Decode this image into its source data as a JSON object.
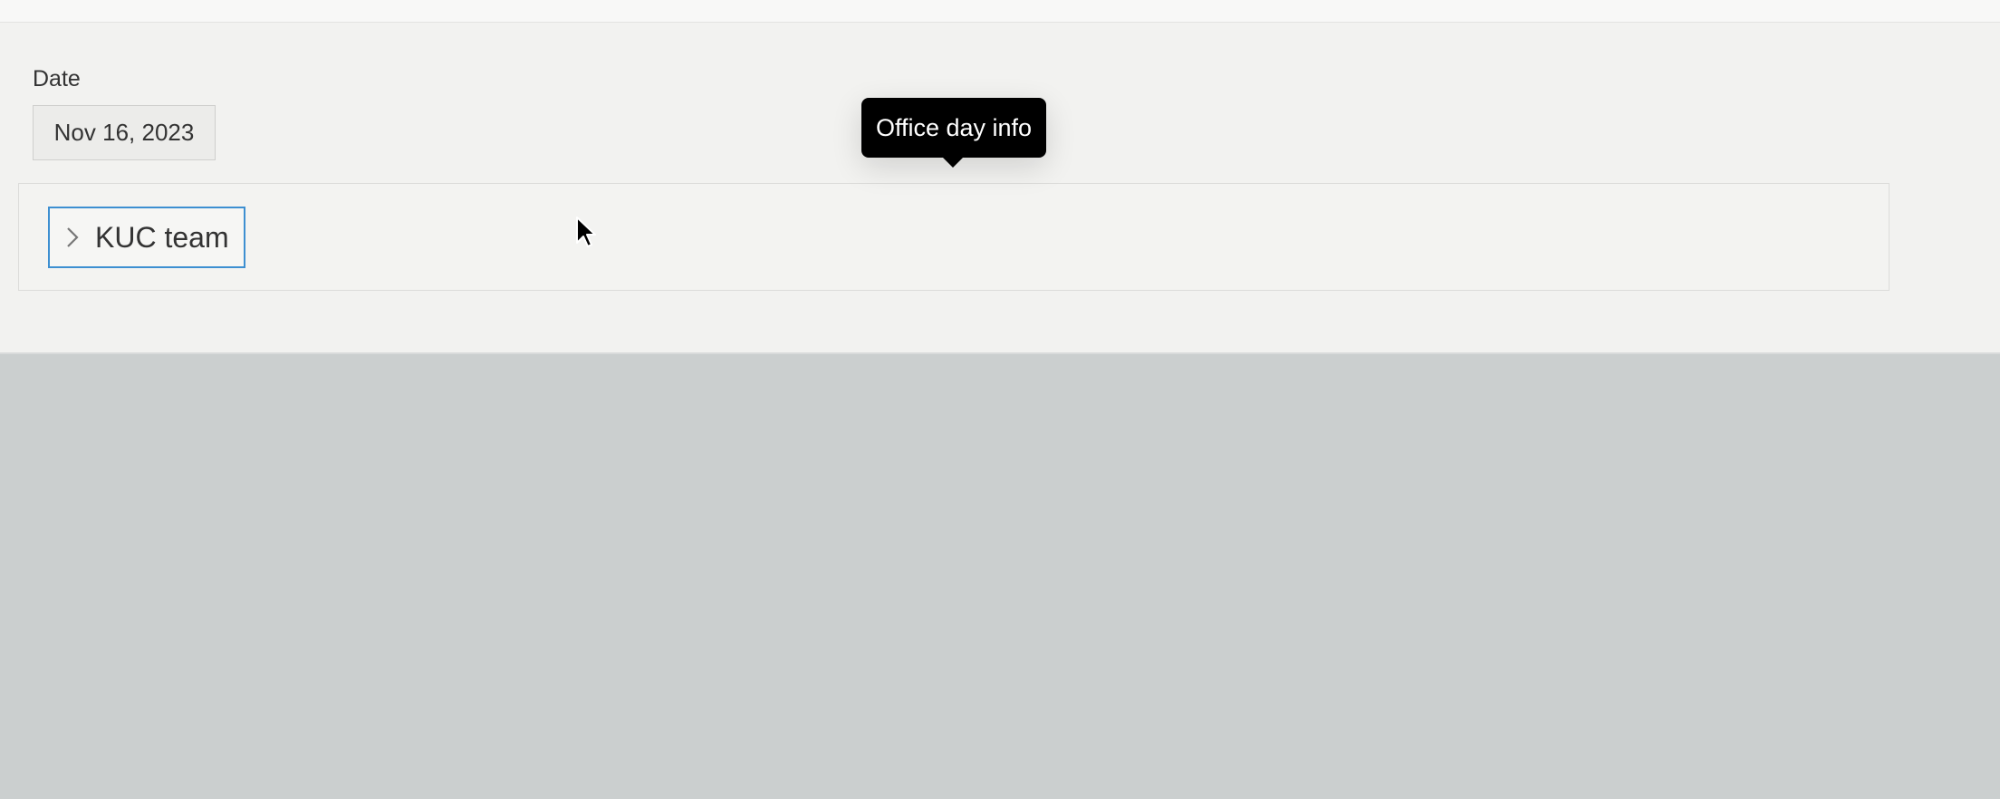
{
  "date_section": {
    "label": "Date",
    "value": "Nov 16, 2023"
  },
  "team": {
    "label": "KUC team",
    "icon": "chevron-right-icon"
  },
  "tooltip": {
    "text": "Office day info"
  },
  "colors": {
    "accent_border": "#3d8fd1",
    "tooltip_bg": "#000000",
    "panel_bg": "#f2f2f0",
    "background": "#cbcfcf"
  }
}
